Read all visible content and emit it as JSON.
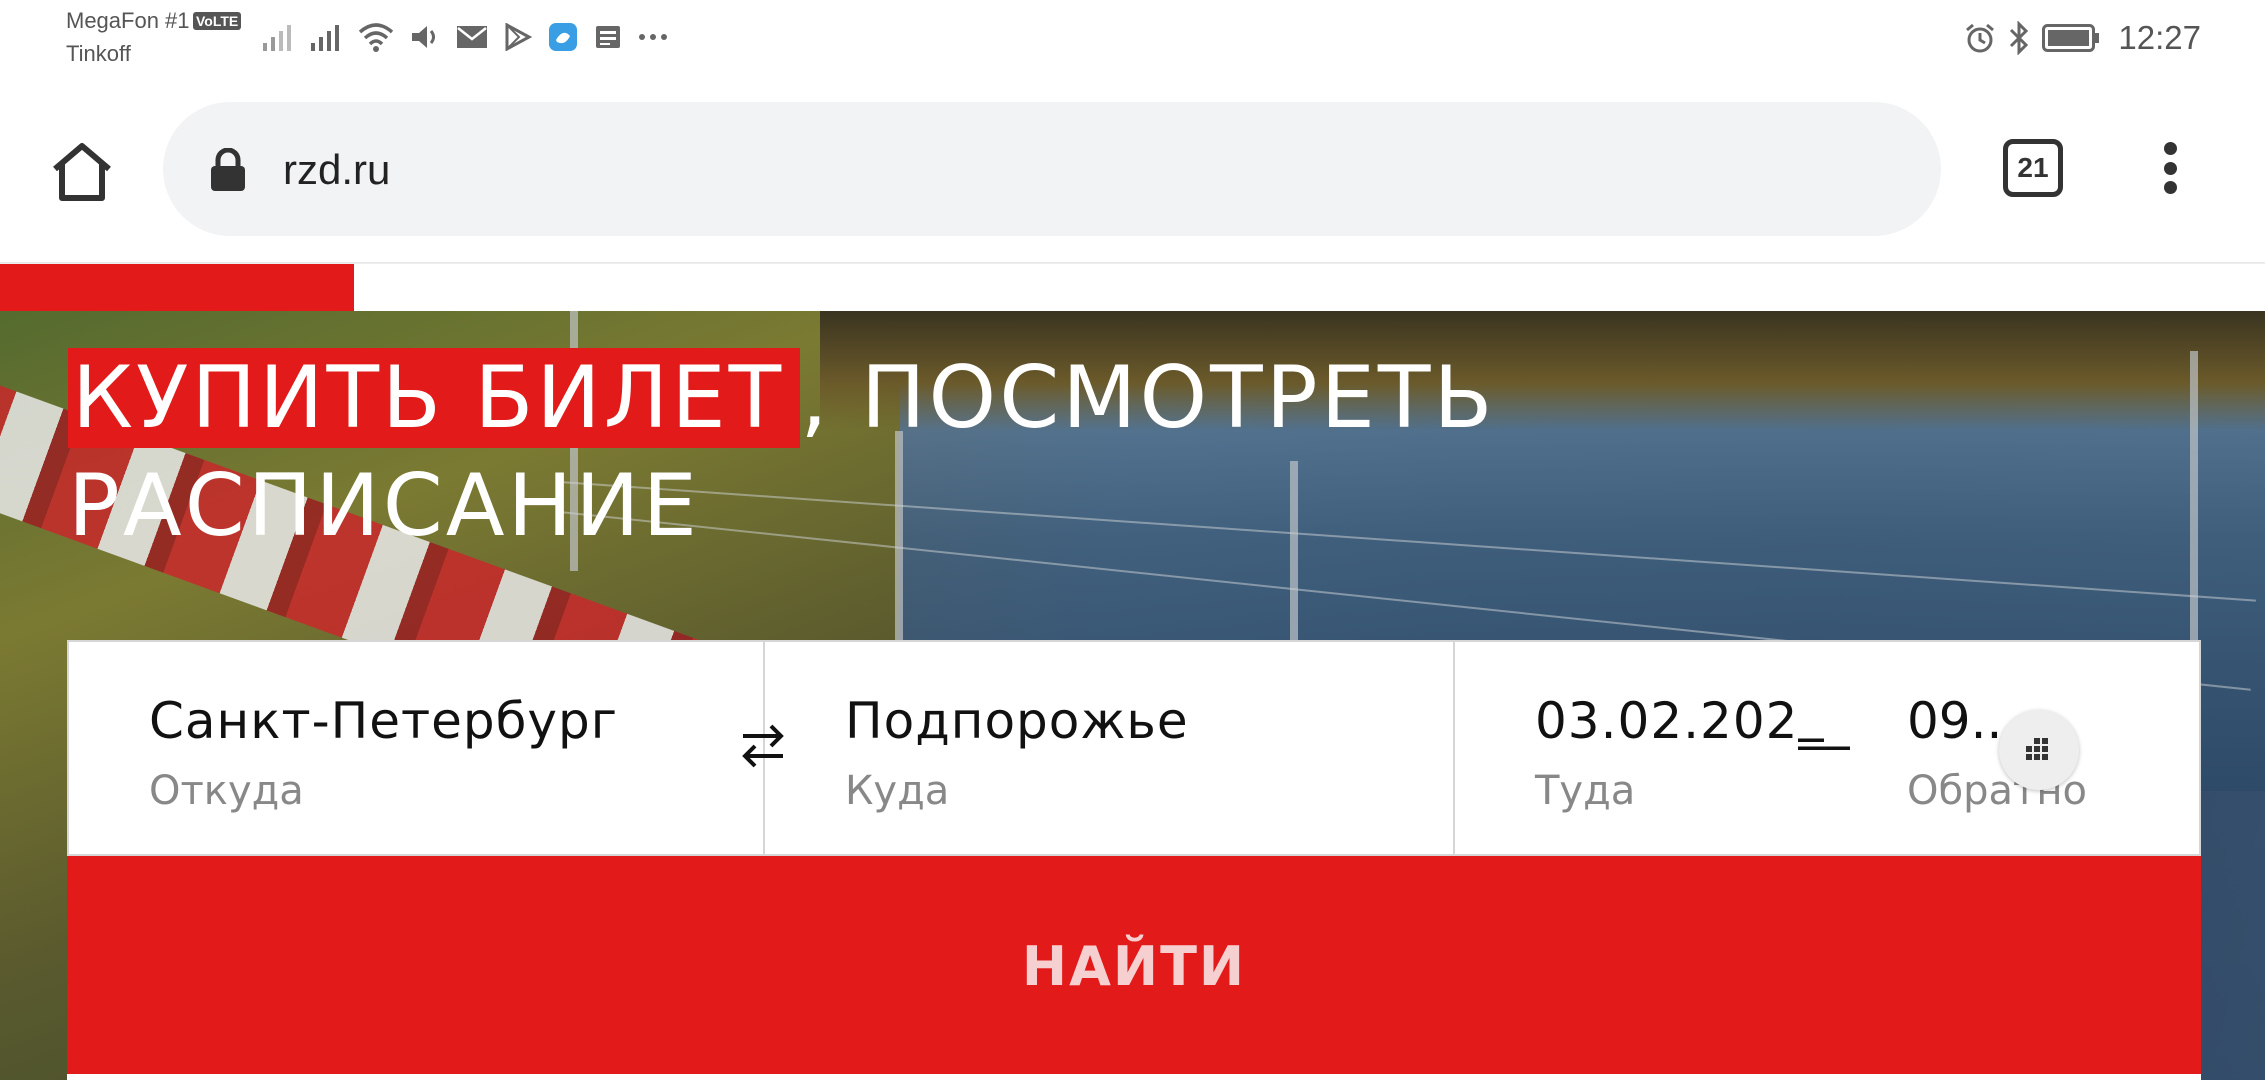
{
  "status_bar": {
    "carrier_1": "MegaFon #1",
    "volte_badge": "VoLTE",
    "carrier_2": "Tinkoff",
    "time": "12:27",
    "icons": [
      "signal-icon",
      "signal-icon",
      "wifi-icon",
      "volume-icon",
      "mail-icon",
      "play-store-icon",
      "app-icon",
      "news-icon",
      "more-icon",
      "alarm-icon",
      "bluetooth-icon",
      "battery-icon"
    ]
  },
  "browser": {
    "url": "rzd.ru",
    "tab_count": "21"
  },
  "hero": {
    "headline_highlight": "КУПИТЬ БИЛЕТ",
    "headline_rest": ", ПОСМОТРЕТЬ",
    "headline_line2": "РАСПИСАНИЕ"
  },
  "search": {
    "from_value": "Санкт-Петербург",
    "from_label": "Откуда",
    "to_value": "Подпорожье",
    "to_label": "Куда",
    "date_there_value": "03.02.202‗_",
    "date_there_label": "Туда",
    "date_back_value": "09....",
    "date_back_label": "Обратно",
    "find_button": "НАЙТИ"
  },
  "colors": {
    "brand_red": "#e21a1a",
    "url_bar_bg": "#f1f3f4"
  }
}
